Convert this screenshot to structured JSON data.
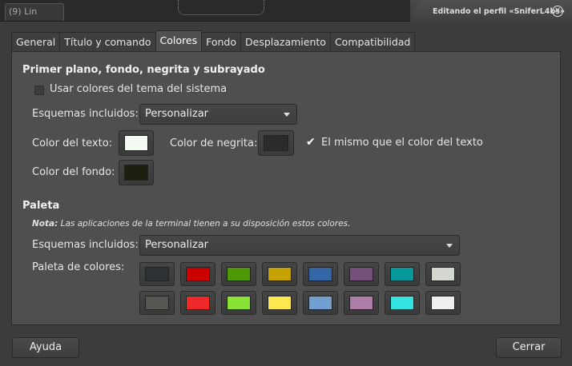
{
  "window": {
    "title": "Editando el perfil «SniferL4bs»",
    "background_tab_label": "(9) Lin"
  },
  "tabs": [
    {
      "label": "General",
      "active": false
    },
    {
      "label": "Título y comando",
      "active": false
    },
    {
      "label": "Colores",
      "active": true
    },
    {
      "label": "Fondo",
      "active": false
    },
    {
      "label": "Desplazamiento",
      "active": false
    },
    {
      "label": "Compatibilidad",
      "active": false
    }
  ],
  "foreground": {
    "heading": "Primer plano, fondo, negrita y subrayado",
    "use_system_colors_label": "Usar colores del tema del sistema",
    "use_system_colors_checked": false,
    "schemes_label": "Esquemas incluidos:",
    "schemes_value": "Personalizar",
    "text_color_label": "Color del texto:",
    "text_color": "#f4fbf2",
    "bold_color_label": "Color de negrita:",
    "bold_same_label": "El mismo que el color del texto",
    "bold_same_checked": true,
    "bg_color_label": "Color del fondo:",
    "bg_color": "#1d2011"
  },
  "palette": {
    "heading": "Paleta",
    "note_bold": "Nota:",
    "note_text": " Las aplicaciones de la terminal tienen a su disposición estos colores.",
    "schemes_label": "Esquemas incluidos:",
    "schemes_value": "Personalizar",
    "palette_label": "Paleta de colores:",
    "row1": [
      "#2e3436",
      "#cc0000",
      "#4e9a06",
      "#c4a000",
      "#3465a4",
      "#75507b",
      "#06989a",
      "#d3d7cf"
    ],
    "row2": [
      "#555753",
      "#ef2929",
      "#8ae234",
      "#fce94f",
      "#729fcf",
      "#ad7fa8",
      "#34e2e2",
      "#eeeeec"
    ]
  },
  "buttons": {
    "help": "Ayuda",
    "close": "Cerrar"
  }
}
